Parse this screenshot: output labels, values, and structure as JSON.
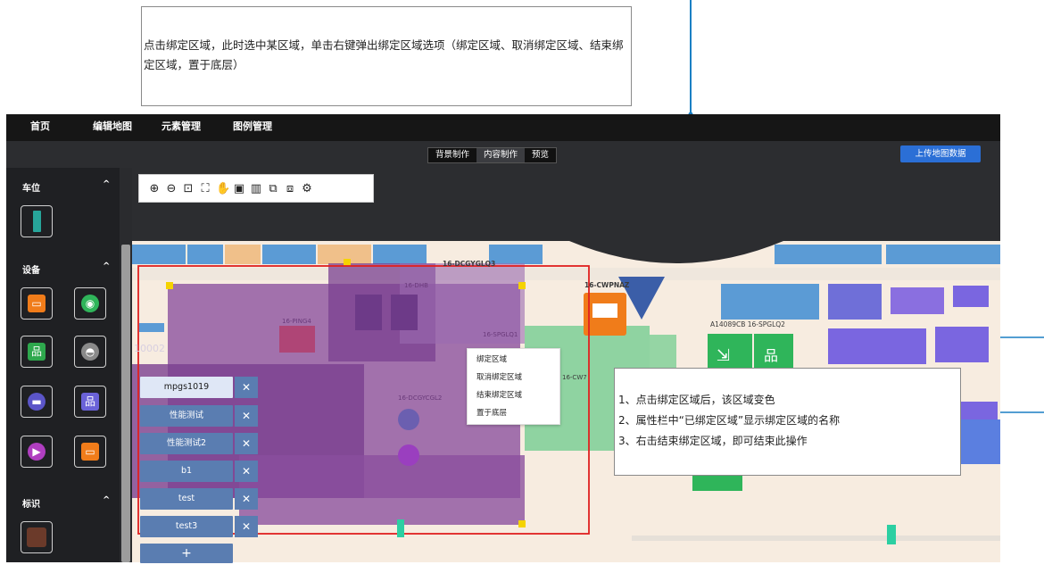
{
  "annotations": {
    "top_note": "点击绑定区域，此时选中某区域，单击右键弹出绑定区域选项（绑定区域、取消绑定区域、结束绑定区域，置于底层）",
    "right_note": [
      "1、点击绑定区域后，该区域变色",
      "2、属性栏中“已绑定区域”显示绑定区域的名称",
      "3、右击结束绑定区域，即可结束此操作"
    ]
  },
  "nav": {
    "items": [
      "首页",
      "编辑地图",
      "元素管理",
      "图例管理"
    ]
  },
  "mode_tabs": [
    "背景制作",
    "内容制作",
    "预览"
  ],
  "upload_button": "上传地图数据",
  "sidebar": {
    "sections": [
      "车位",
      "设备",
      "标识"
    ],
    "collapse_glyph": "^"
  },
  "toolbar_icons": [
    "zoom-in-icon",
    "zoom-out-icon",
    "fit-icon",
    "fullscreen-icon",
    "hand-icon",
    "save-icon",
    "delete-icon",
    "copy-icon",
    "paste-icon",
    "settings-icon"
  ],
  "map_labels": {
    "l1": "16-DCGYGLQ3",
    "l2": "16-CWPNAZ",
    "l3": "A14089CB 16-SPGLQ2",
    "l4": "16-PING4",
    "l5": "16-SPGLQ1",
    "l6": "16-CW7",
    "l7": "16-DCGYCGL2",
    "l8": "10002",
    "l9": "16-DHB"
  },
  "context_menu": [
    "绑定区域",
    "取消绑定区域",
    "结束绑定区域",
    "置于底层"
  ],
  "area_tags": [
    "mpgs1019",
    "性能测试",
    "性能测试2",
    "b1",
    "test",
    "test3"
  ],
  "tag_remove": "✕",
  "add_button": "+",
  "colors": {
    "accent": "#2b6fd6",
    "selection": "#e02020",
    "bound_area": "#8a4e9e",
    "connector": "#1a7fc4"
  }
}
